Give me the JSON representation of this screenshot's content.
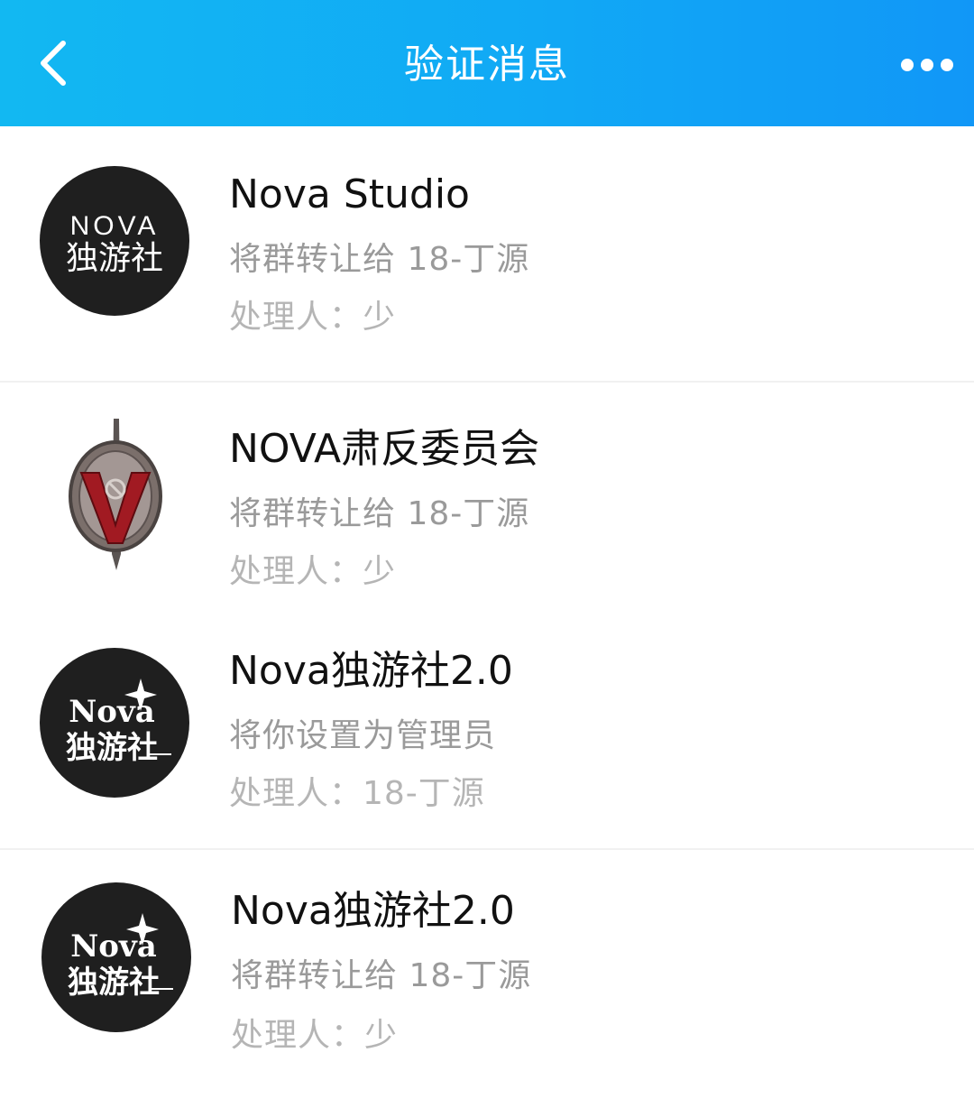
{
  "header": {
    "title": "验证消息",
    "back_icon": "chevron-left-icon",
    "more_icon": "more-dots-icon",
    "gradient_start": "#12b8f2",
    "gradient_end": "#1197f7"
  },
  "avatar_logos": {
    "nova_line1": "NOVA",
    "nova_line2": "独游社",
    "nova2_line1": "Nova",
    "nova2_line2": "独游社"
  },
  "messages": [
    {
      "group_name": "Nova Studio",
      "action": "将群转让给 18-丁源",
      "handler": "处理人：少",
      "avatar": "nova-studio-logo"
    },
    {
      "group_name": "NOVA肃反委员会",
      "action": "将群转让给 18-丁源",
      "handler": "处理人：少",
      "avatar": "badge-emblem"
    },
    {
      "group_name": "Nova独游社2.0",
      "action": "将你设置为管理员",
      "handler": "处理人：18-丁源",
      "avatar": "nova-2-logo"
    },
    {
      "group_name": "Nova独游社2.0",
      "action": "将群转让给 18-丁源",
      "handler": "处理人：少",
      "avatar": "nova-2-logo"
    }
  ]
}
